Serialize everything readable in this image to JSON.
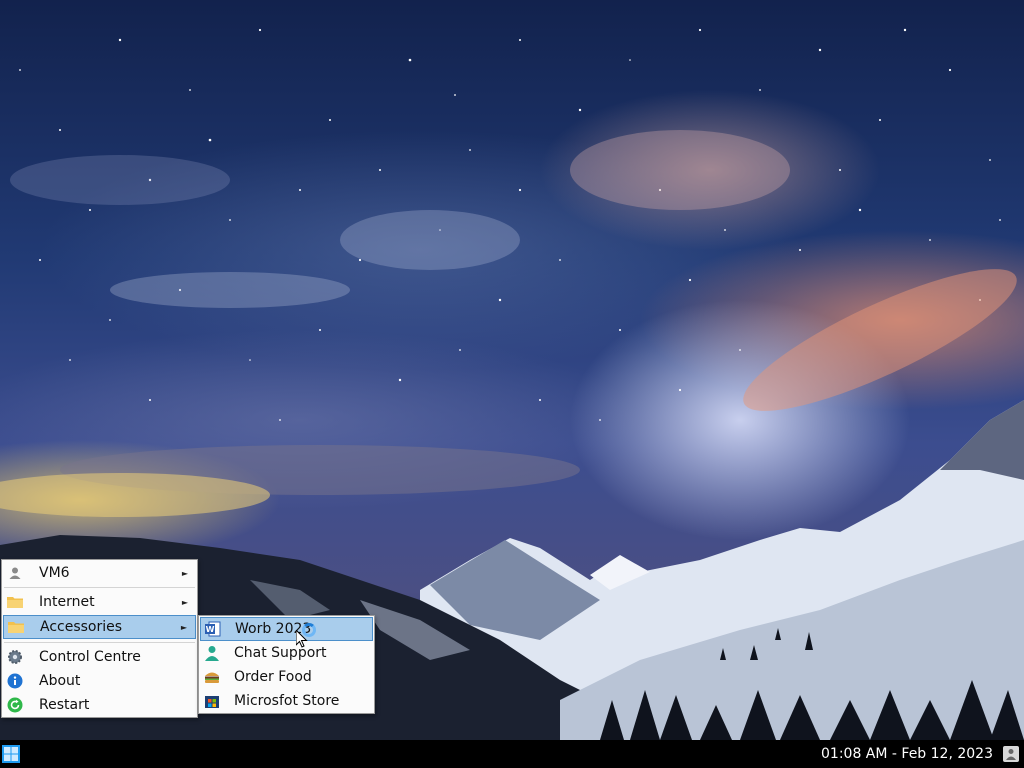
{
  "desktop": {
    "wallpaper": "starry-night-snowy-mountains"
  },
  "start_menu": {
    "items": [
      {
        "label": "VM6",
        "icon": "user-icon",
        "has_submenu": true
      },
      {
        "label": "Internet",
        "icon": "folder-icon",
        "has_submenu": true
      },
      {
        "label": "Accessories",
        "icon": "folder-icon",
        "has_submenu": true,
        "highlighted": true
      },
      {
        "label": "Control Centre",
        "icon": "gear-icon"
      },
      {
        "label": "About",
        "icon": "info-icon"
      },
      {
        "label": "Restart",
        "icon": "restart-icon"
      }
    ],
    "arrow": "►"
  },
  "accessories_submenu": {
    "items": [
      {
        "label": "Worb 2023",
        "icon": "word-icon",
        "highlighted": true
      },
      {
        "label": "Chat Support",
        "icon": "person-icon"
      },
      {
        "label": "Order Food",
        "icon": "burger-icon"
      },
      {
        "label": "Microsfot Store",
        "icon": "store-icon"
      }
    ]
  },
  "taskbar": {
    "clock": "01:08 AM - Feb 12, 2023",
    "start_icon": "windows-logo-icon",
    "tray_icon": "user-icon"
  },
  "colors": {
    "highlight_bg": "#a9cdec",
    "highlight_border": "#4c8fca",
    "taskbar": "#000000",
    "start_blue": "#1e9bf0"
  }
}
